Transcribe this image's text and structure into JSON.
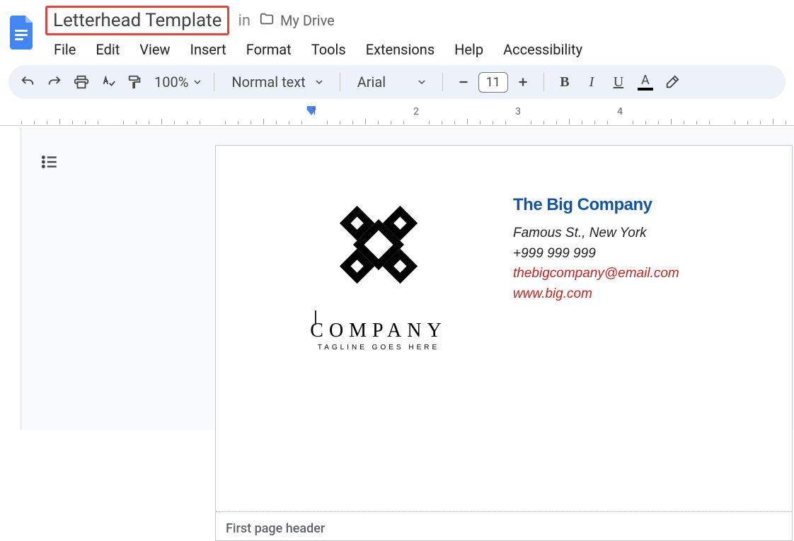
{
  "doc": {
    "title": "Letterhead Template",
    "location_in": "in",
    "drive_folder": "My Drive"
  },
  "menubar": [
    "File",
    "Edit",
    "View",
    "Insert",
    "Format",
    "Tools",
    "Extensions",
    "Help",
    "Accessibility"
  ],
  "toolbar": {
    "zoom": "100%",
    "paragraph_style": "Normal text",
    "font": "Arial",
    "font_size": "11"
  },
  "ruler": {
    "numbers": [
      1,
      2,
      3,
      4
    ]
  },
  "letterhead": {
    "logo_text": "COMPANY",
    "tagline": "TAGLINE GOES HERE",
    "company_name": "The Big Company",
    "address": "Famous St., New York",
    "phone": "+999 999 999",
    "email": "thebigcompany@email.com",
    "website": "www.big.com"
  },
  "page_header_label": "First page header"
}
